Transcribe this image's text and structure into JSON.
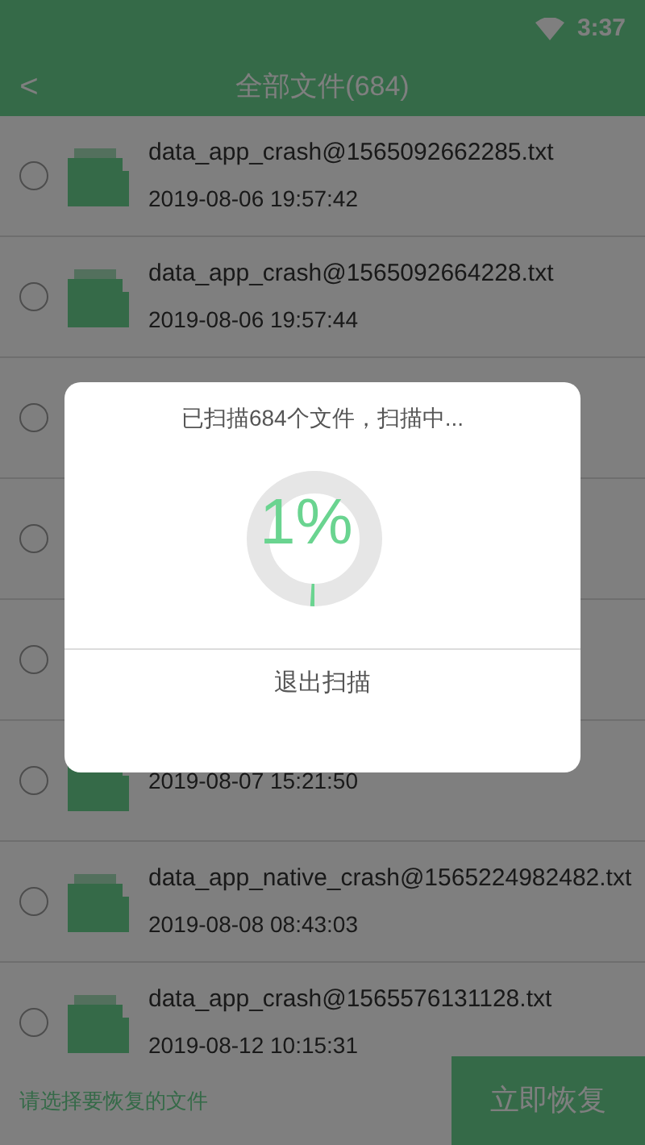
{
  "status_bar": {
    "time": "3:37"
  },
  "header": {
    "back": "<",
    "title": "全部文件(684)"
  },
  "files": [
    {
      "name": "data_app_crash@1565092662285.txt",
      "date": "2019-08-06 19:57:42",
      "selected": false
    },
    {
      "name": "data_app_crash@1565092664228.txt",
      "date": "2019-08-06 19:57:44",
      "selected": false
    },
    {
      "selected": false
    },
    {
      "selected": false
    },
    {
      "selected": false
    },
    {
      "date": "2019-08-07 15:21:50",
      "selected": false
    },
    {
      "name": "data_app_native_crash@1565224982482.txt",
      "date": "2019-08-08 08:43:03",
      "selected": false
    },
    {
      "name": "data_app_crash@1565576131128.txt",
      "date": "2019-08-12 10:15:31",
      "selected": false
    }
  ],
  "footer": {
    "hint": "请选择要恢复的文件",
    "button": "立即恢复"
  },
  "dialog": {
    "message": "已扫描684个文件，扫描中...",
    "percent": "1%",
    "level": 0.01,
    "button": "退出扫描"
  }
}
